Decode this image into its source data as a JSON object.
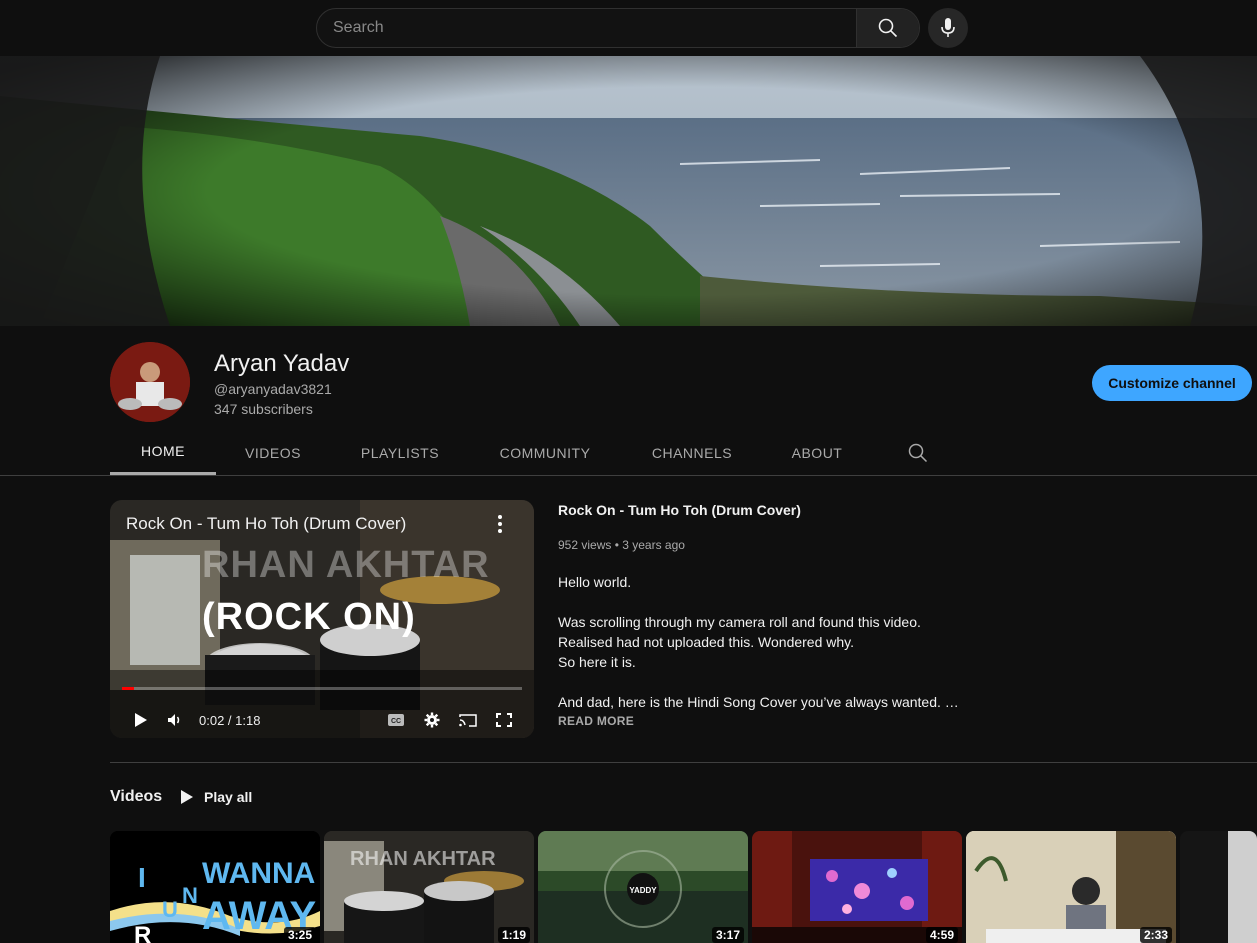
{
  "search": {
    "placeholder": "Search"
  },
  "channel": {
    "name": "Aryan Yadav",
    "handle": "@aryanyadav3821",
    "subscribers": "347 subscribers",
    "customize_label": "Customize channel"
  },
  "tabs": [
    {
      "label": "HOME"
    },
    {
      "label": "VIDEOS"
    },
    {
      "label": "PLAYLISTS"
    },
    {
      "label": "COMMUNITY"
    },
    {
      "label": "CHANNELS"
    },
    {
      "label": "ABOUT"
    }
  ],
  "featured": {
    "player_title": "Rock On - Tum Ho Toh (Drum Cover)",
    "overlay_top": "RHAN AKHTAR",
    "overlay_main": "(ROCK ON)",
    "time": "0:02 / 1:18",
    "progress": 0.03,
    "title": "Rock On - Tum Ho Toh (Drum Cover)",
    "meta": "952 views • 3 years ago",
    "desc": [
      "Hello world.",
      "Was scrolling through my camera roll and found this video.\nRealised had not uploaded this. Wondered why.\nSo here it is.",
      "And dad, here is the Hindi Song Cover you’ve always wanted. …"
    ],
    "read_more": "READ MORE"
  },
  "videos_section": {
    "title": "Videos",
    "play_all": "Play all",
    "items": [
      {
        "duration": "3:25",
        "thumb_text": "I WANNA RUN AWAY"
      },
      {
        "duration": "1:19",
        "thumb_text": "RHAN AKHTAR"
      },
      {
        "duration": "3:17",
        "thumb_text": "YADDY"
      },
      {
        "duration": "4:59",
        "thumb_text": ""
      },
      {
        "duration": "2:33",
        "thumb_text": ""
      }
    ]
  },
  "colors": {
    "accent": "#3ea6ff",
    "background": "#0f0f0f",
    "progress": "#ff0000"
  }
}
